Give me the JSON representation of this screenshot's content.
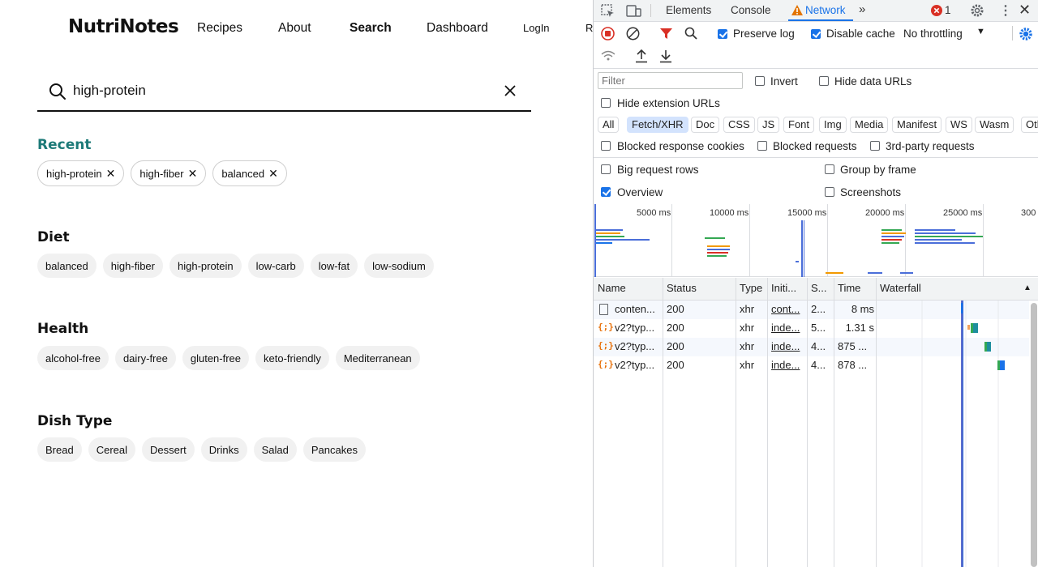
{
  "app": {
    "logo": "NutriNotes",
    "nav": [
      "Recipes",
      "About",
      "Search",
      "Dashboard",
      "LogIn",
      "R"
    ],
    "search": {
      "value": "high-protein"
    },
    "recent": {
      "title": "Recent",
      "chips": [
        "high-protein",
        "high-fiber",
        "balanced"
      ]
    },
    "sections": [
      {
        "title": "Diet",
        "chips": [
          "balanced",
          "high-fiber",
          "high-protein",
          "low-carb",
          "low-fat",
          "low-sodium"
        ]
      },
      {
        "title": "Health",
        "chips": [
          "alcohol-free",
          "dairy-free",
          "gluten-free",
          "keto-friendly",
          "Mediterranean"
        ]
      },
      {
        "title": "Dish Type",
        "chips": [
          "Bread",
          "Cereal",
          "Dessert",
          "Drinks",
          "Salad",
          "Pancakes"
        ]
      }
    ]
  },
  "devtools": {
    "tabs": [
      "Elements",
      "Console",
      "Network"
    ],
    "active_tab": "Network",
    "error_count": "1",
    "toolbar": {
      "preserve_log": "Preserve log",
      "disable_cache": "Disable cache",
      "throttling": "No throttling"
    },
    "filter_placeholder": "Filter",
    "invert": "Invert",
    "hide_data_urls": "Hide data URLs",
    "hide_extension_urls": "Hide extension URLs",
    "types": [
      "All",
      "Fetch/XHR",
      "Doc",
      "CSS",
      "JS",
      "Font",
      "Img",
      "Media",
      "Manifest",
      "WS",
      "Wasm",
      "Oth"
    ],
    "active_type": "Fetch/XHR",
    "blocked_cookies": "Blocked response cookies",
    "blocked_requests": "Blocked requests",
    "third_party": "3rd-party requests",
    "big_rows": "Big request rows",
    "group_by_frame": "Group by frame",
    "overview": "Overview",
    "screenshots": "Screenshots",
    "overview_ticks": [
      "5000 ms",
      "10000 ms",
      "15000 ms",
      "20000 ms",
      "25000 ms",
      "300"
    ],
    "columns": [
      "Name",
      "Status",
      "Type",
      "Initi...",
      "S...",
      "Time",
      "Waterfall"
    ],
    "requests": [
      {
        "name": "conten...",
        "status": "200",
        "type": "xhr",
        "initiator": "cont...",
        "size": "2...",
        "time": "8 ms",
        "icon": "document-icon"
      },
      {
        "name": "v2?typ...",
        "status": "200",
        "type": "xhr",
        "initiator": "inde...",
        "size": "5...",
        "time": "1.31 s",
        "icon": "xhr-icon"
      },
      {
        "name": "v2?typ...",
        "status": "200",
        "type": "xhr",
        "initiator": "inde...",
        "size": "4...",
        "time": "875 ...",
        "icon": "xhr-icon"
      },
      {
        "name": "v2?typ...",
        "status": "200",
        "type": "xhr",
        "initiator": "inde...",
        "size": "4...",
        "time": "878 ...",
        "icon": "xhr-icon"
      }
    ]
  }
}
